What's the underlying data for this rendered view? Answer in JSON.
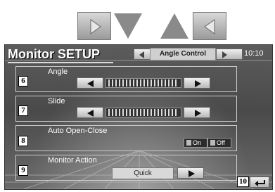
{
  "screen": {
    "title": "Monitor SETUP",
    "clock": "10:10",
    "control_selector": "Angle Control"
  },
  "sections": {
    "angle": {
      "label": "Angle",
      "badge": "6"
    },
    "slide": {
      "label": "Slide",
      "badge": "7"
    },
    "auto_open_close": {
      "label": "Auto Open-Close",
      "badge": "8",
      "on_label": "On",
      "off_label": "Off"
    },
    "monitor_action": {
      "label": "Monitor Action",
      "badge": "9",
      "value": "Quick"
    }
  },
  "return_badge": "10",
  "icons": {
    "top_nav": [
      "right-arrow-icon",
      "down-arrow-icon",
      "up-arrow-icon",
      "left-arrow-icon"
    ],
    "return": "return-icon"
  },
  "colors": {
    "screen_bg": "#4f4f4f",
    "text": "#ffffff",
    "button_face": "#d8d8d8"
  }
}
